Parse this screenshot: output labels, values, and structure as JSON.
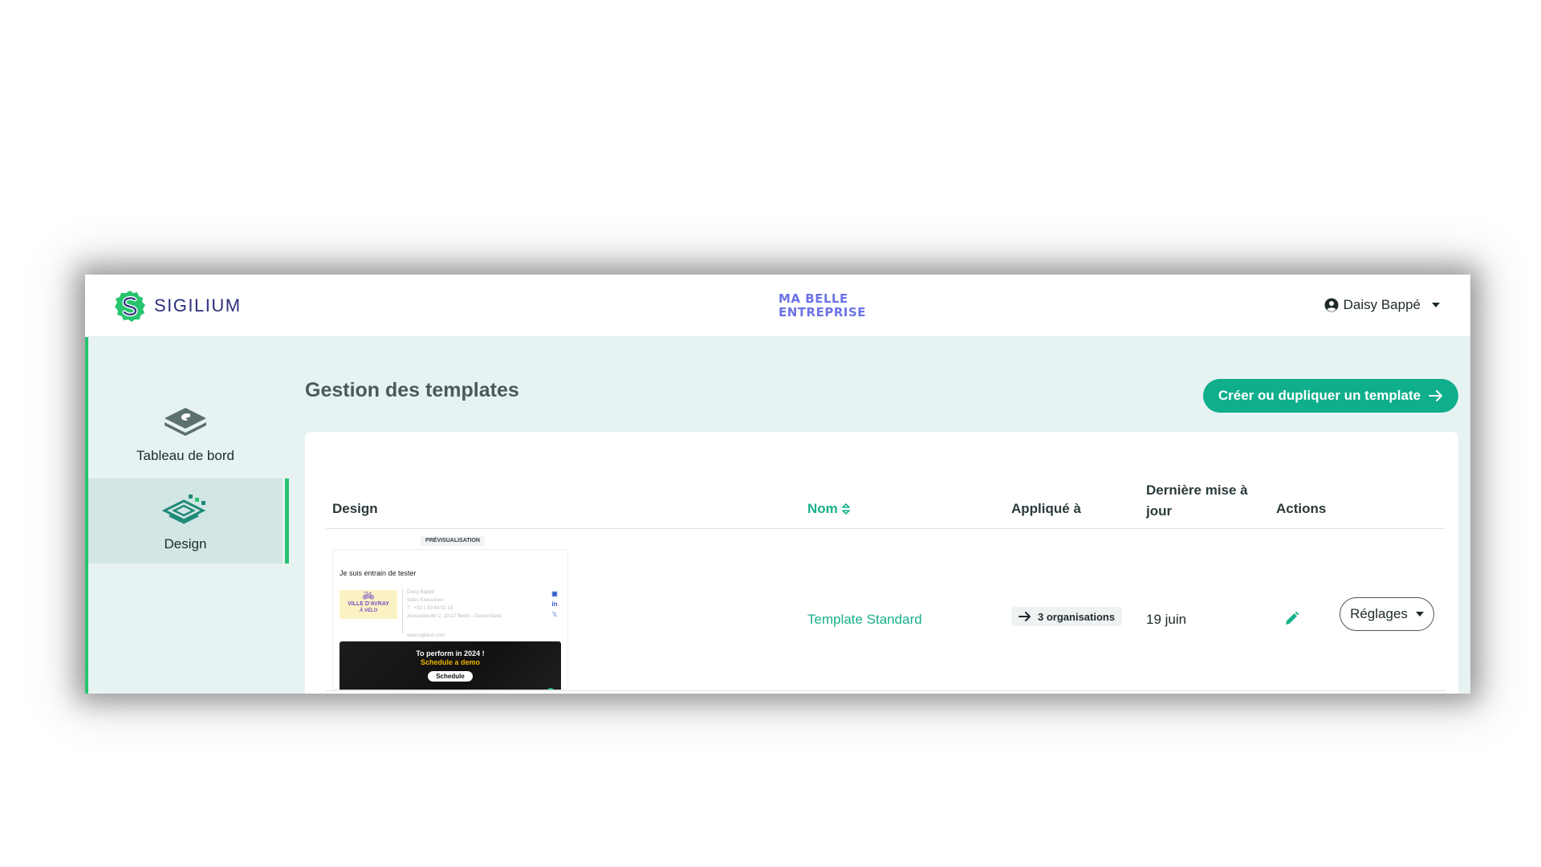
{
  "header": {
    "brand_name": "SIGILIUM",
    "company_line1": "MA BELLE",
    "company_line2": "ENTREPRISE",
    "user_name": "Daisy Bappé"
  },
  "sidebar": {
    "items": [
      {
        "label": "Tableau de bord",
        "icon": "dashboard-icon",
        "active": false
      },
      {
        "label": "Design",
        "icon": "design-icon",
        "active": true
      }
    ]
  },
  "main": {
    "title": "Gestion des templates",
    "create_button": "Créer ou dupliquer un template",
    "columns": {
      "design": "Design",
      "name": "Nom",
      "applied_to": "Appliqué à",
      "last_update": "Dernière mise à jour",
      "actions": "Actions"
    },
    "rows": [
      {
        "name": "Template Standard",
        "applied_to": "3 organisations",
        "last_update": "19 juin",
        "settings_label": "Réglages",
        "preview": {
          "tag": "PRÉVISUALISATION",
          "greeting": "Je suis entrain de tester",
          "logo_line1": "VILLE D'AVRAY",
          "logo_line2": "À VÉLO",
          "info_name": "Daisy Bappé",
          "info_role": "Sales Executives",
          "info_phone": "T : +33 1 83 64 02 13",
          "info_address": "Alexanderufer 2, 10117 Berlin - Deutschland",
          "info_url": "www.sigilium.com",
          "banner_line1": "To perform in 2024 !",
          "banner_line2": "Schedule a demo",
          "banner_button": "Schedule"
        }
      }
    ]
  },
  "colors": {
    "accent": "#0fae8c",
    "active_bar": "#27c46e",
    "background": "#e7f3f2",
    "company": "#6b73e6",
    "brand_text": "#2d2f7a"
  }
}
